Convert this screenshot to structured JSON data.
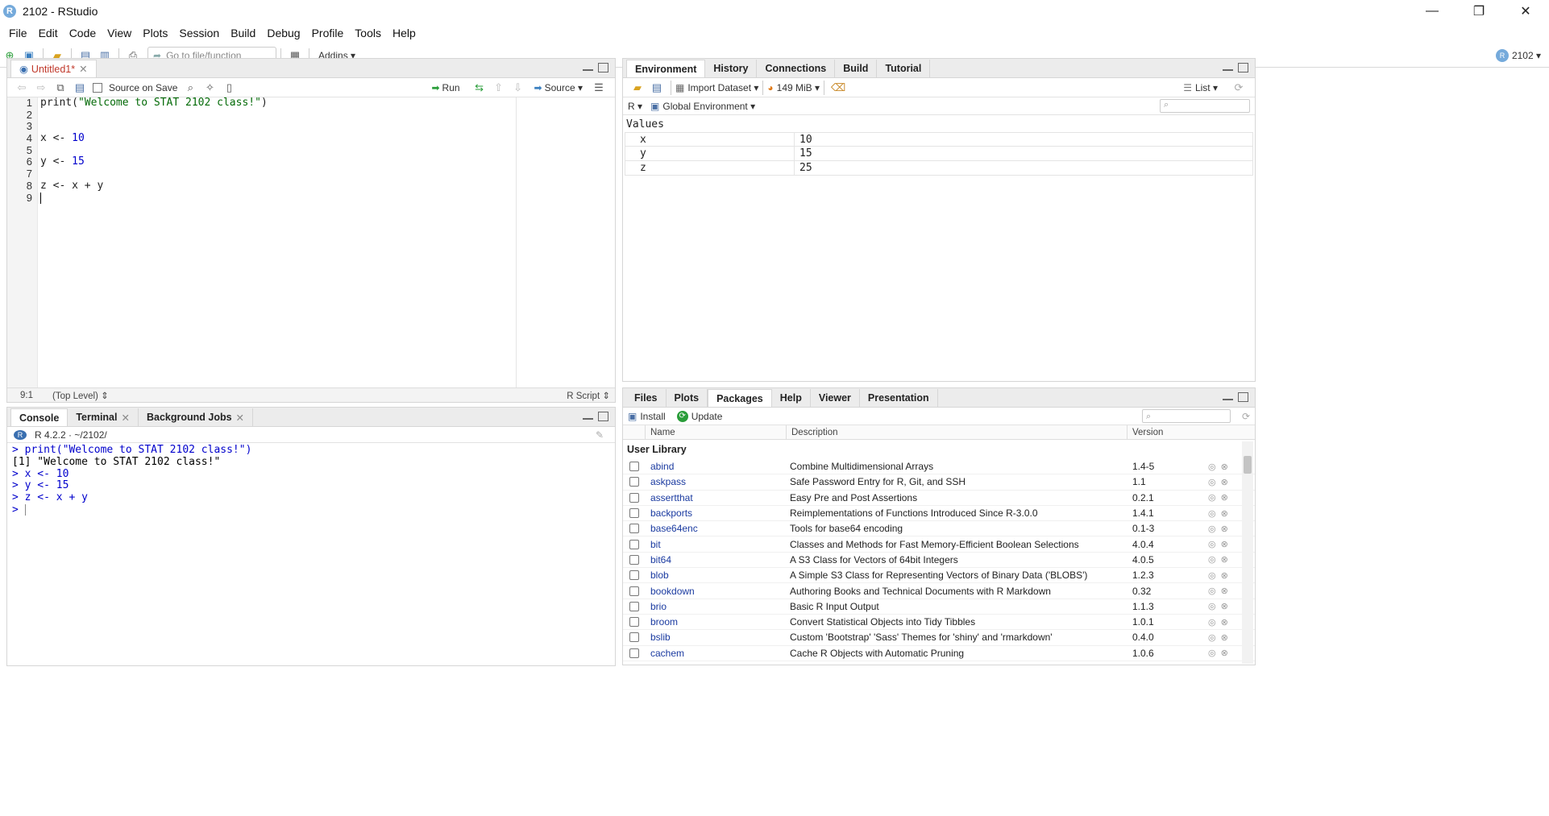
{
  "window": {
    "title": "2102 - RStudio",
    "logo_letter": "R"
  },
  "menu": [
    "File",
    "Edit",
    "Code",
    "View",
    "Plots",
    "Session",
    "Build",
    "Debug",
    "Profile",
    "Tools",
    "Help"
  ],
  "toolbar": {
    "goto_placeholder": "Go to file/function",
    "addins_label": "Addins",
    "project_label": "2102"
  },
  "source": {
    "tab_label": "Untitled1*",
    "source_on_save": "Source on Save",
    "run_label": "Run",
    "source_label": "Source",
    "lines": [
      {
        "n": "1",
        "code": "print(\"Welcome to STAT 2102 class!\")"
      },
      {
        "n": "2",
        "code": ""
      },
      {
        "n": "3",
        "code": ""
      },
      {
        "n": "4",
        "code": "x <- 10"
      },
      {
        "n": "5",
        "code": ""
      },
      {
        "n": "6",
        "code": "y <- 15"
      },
      {
        "n": "7",
        "code": ""
      },
      {
        "n": "8",
        "code": "z <- x + y"
      },
      {
        "n": "9",
        "code": ""
      }
    ],
    "status_pos": "9:1",
    "status_scope": "(Top Level)",
    "status_type": "R Script"
  },
  "console": {
    "tabs": [
      "Console",
      "Terminal",
      "Background Jobs"
    ],
    "version": "R 4.2.2 · ~/2102/",
    "lines": [
      {
        "text": "> print(\"Welcome to STAT 2102 class!\")",
        "kind": "in"
      },
      {
        "text": "[1] \"Welcome to STAT 2102 class!\"",
        "kind": "out"
      },
      {
        "text": "> x <- 10",
        "kind": "in"
      },
      {
        "text": "> y <- 15",
        "kind": "in"
      },
      {
        "text": "> z <- x + y",
        "kind": "in"
      },
      {
        "text": "> ",
        "kind": "in"
      }
    ]
  },
  "environment": {
    "tabs": [
      "Environment",
      "History",
      "Connections",
      "Build",
      "Tutorial"
    ],
    "import_label": "Import Dataset",
    "memory_label": "149 MiB",
    "list_label": "List",
    "lang_label": "R",
    "scope_label": "Global Environment",
    "values_header": "Values",
    "values": [
      {
        "name": "x",
        "value": "10"
      },
      {
        "name": "y",
        "value": "15"
      },
      {
        "name": "z",
        "value": "25"
      }
    ]
  },
  "packages": {
    "tabs": [
      "Files",
      "Plots",
      "Packages",
      "Help",
      "Viewer",
      "Presentation"
    ],
    "install_label": "Install",
    "update_label": "Update",
    "columns": [
      "Name",
      "Description",
      "Version"
    ],
    "section": "User Library",
    "rows": [
      {
        "name": "abind",
        "desc": "Combine Multidimensional Arrays",
        "ver": "1.4-5"
      },
      {
        "name": "askpass",
        "desc": "Safe Password Entry for R, Git, and SSH",
        "ver": "1.1"
      },
      {
        "name": "assertthat",
        "desc": "Easy Pre and Post Assertions",
        "ver": "0.2.1"
      },
      {
        "name": "backports",
        "desc": "Reimplementations of Functions Introduced Since R-3.0.0",
        "ver": "1.4.1"
      },
      {
        "name": "base64enc",
        "desc": "Tools for base64 encoding",
        "ver": "0.1-3"
      },
      {
        "name": "bit",
        "desc": "Classes and Methods for Fast Memory-Efficient Boolean Selections",
        "ver": "4.0.4"
      },
      {
        "name": "bit64",
        "desc": "A S3 Class for Vectors of 64bit Integers",
        "ver": "4.0.5"
      },
      {
        "name": "blob",
        "desc": "A Simple S3 Class for Representing Vectors of Binary Data ('BLOBS')",
        "ver": "1.2.3"
      },
      {
        "name": "bookdown",
        "desc": "Authoring Books and Technical Documents with R Markdown",
        "ver": "0.32"
      },
      {
        "name": "brio",
        "desc": "Basic R Input Output",
        "ver": "1.1.3"
      },
      {
        "name": "broom",
        "desc": "Convert Statistical Objects into Tidy Tibbles",
        "ver": "1.0.1"
      },
      {
        "name": "bslib",
        "desc": "Custom 'Bootstrap' 'Sass' Themes for 'shiny' and 'rmarkdown'",
        "ver": "0.4.0"
      },
      {
        "name": "cachem",
        "desc": "Cache R Objects with Automatic Pruning",
        "ver": "1.0.6"
      }
    ]
  }
}
